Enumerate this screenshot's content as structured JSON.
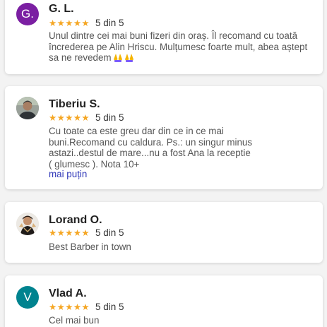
{
  "colors": {
    "star": "#f5a623",
    "link": "#2f37b8",
    "avatar_purple": "#7b1fa2",
    "avatar_teal": "#00838f"
  },
  "reviews": [
    {
      "author": "G. L.",
      "avatar_letter": "G.",
      "stars": "★★★★★",
      "rating": "5 din 5",
      "text": "Unul dintre cei mai buni fizeri din oraș. Îl recomand cu toată încrederea pe Alin Hriscu. Mulțumesc foarte mult, abea aștept sa ne revedem",
      "emoji": "folded-hands-icon"
    },
    {
      "author": "Tiberiu S.",
      "avatar_icon": "profile-photo",
      "stars": "★★★★★",
      "rating": "5 din 5",
      "text": "Cu toate ca este greu dar din ce in ce mai buni.Recomand cu caldura. Ps.: un singur minus astazi..destul de mare...nu a fost Ana la receptie ( glumesc ). Nota 10+",
      "toggle_label": "mai puțin"
    },
    {
      "author": "Lorand O.",
      "avatar_icon": "profile-photo",
      "stars": "★★★★★",
      "rating": "5 din 5",
      "text": "Best Barber in town"
    },
    {
      "author": "Vlad A.",
      "avatar_letter": "V",
      "stars": "★★★★★",
      "rating": "5 din 5",
      "text": "Cel mai bun"
    }
  ]
}
